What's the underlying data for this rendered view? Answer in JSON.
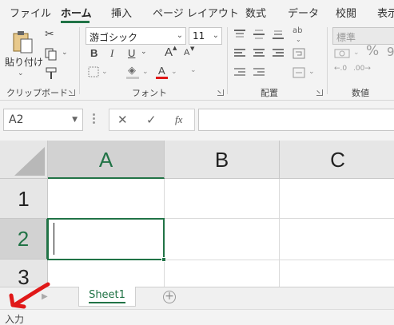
{
  "ribbon_tabs": [
    "ファイル",
    "ホーム",
    "挿入",
    "ページ レイアウト",
    "数式",
    "データ",
    "校閲",
    "表示"
  ],
  "clipboard": {
    "paste_label": "貼り付け",
    "group_label": "クリップボード"
  },
  "font": {
    "name": "游ゴシック",
    "size": "11",
    "group_label": "フォント",
    "bold": "B",
    "italic": "I",
    "underline": "U",
    "grow": "A",
    "shrink": "A",
    "font_color_letter": "A"
  },
  "alignment": {
    "group_label": "配置",
    "wrap_glyph": "ab"
  },
  "number": {
    "format": "標準",
    "percent": "%",
    "group_label": "数値"
  },
  "formula_bar": {
    "name_box": "A2",
    "cancel": "✕",
    "enter": "✓",
    "fx": "fx",
    "formula": ""
  },
  "grid": {
    "columns": [
      "A",
      "B",
      "C"
    ],
    "rows": [
      "1",
      "2",
      "3"
    ],
    "active_cell": "A2"
  },
  "sheets": [
    "Sheet1"
  ],
  "add_sheet": "+",
  "status": "入力",
  "colors": {
    "accent": "#217346",
    "annotation": "#e01818"
  }
}
